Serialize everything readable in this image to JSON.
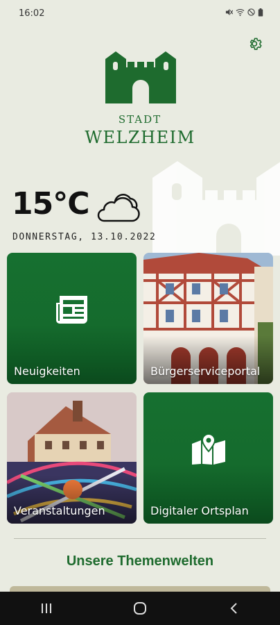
{
  "status_bar": {
    "time": "16:02",
    "icons": [
      "mute-icon",
      "wifi-icon",
      "blocked-icon",
      "battery-icon"
    ]
  },
  "header": {
    "line1": "STADT",
    "line2": "WELZHEIM"
  },
  "weather": {
    "temperature": "15°C",
    "date": "DONNERSTAG, 13.10.2022",
    "icon": "cloud-icon"
  },
  "tiles": [
    {
      "label": "Neuigkeiten",
      "icon": "newspaper-icon"
    },
    {
      "label": "Bürgerserviceportal",
      "icon": "town-hall-photo"
    },
    {
      "label": "Veranstaltungen",
      "icon": "fair-photo"
    },
    {
      "label": "Digitaler Ortsplan",
      "icon": "map-pin-icon"
    }
  ],
  "section": {
    "title": "Unsere Themenwelten"
  },
  "colors": {
    "brand_green": "#1e6b2e",
    "background": "#e9ebe1"
  }
}
